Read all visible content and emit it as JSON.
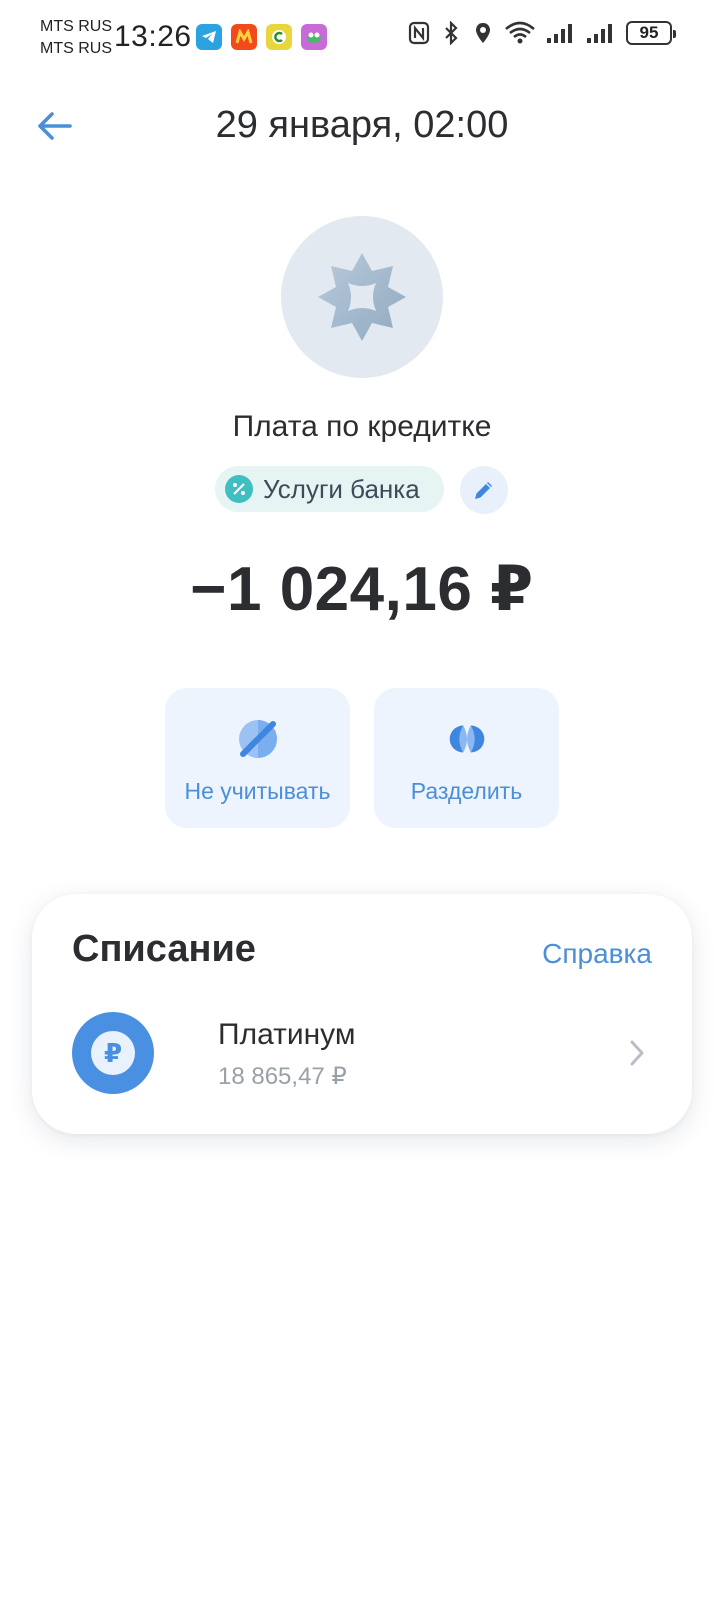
{
  "status_bar": {
    "carrier_1": "MTS RUS",
    "carrier_2": "MTS RUS",
    "time": "13:26",
    "battery": "95",
    "app_icons": [
      "telegram-icon",
      "app-red-icon",
      "app-yellow-icon",
      "app-purple-icon"
    ],
    "system_icons": [
      "nfc-icon",
      "bluetooth-icon",
      "location-icon",
      "wifi-icon",
      "signal-icon",
      "signal-icon"
    ]
  },
  "header": {
    "title": "29 января, 02:00",
    "back_icon": "arrow-left-icon"
  },
  "transaction": {
    "avatar_icon": "bank-badge-icon",
    "name": "Плата по кредитке",
    "category": {
      "label": "Услуги банка",
      "icon": "percent-icon"
    },
    "edit_icon": "pencil-icon",
    "amount": "−1 024,16 ₽"
  },
  "actions": {
    "ignore": {
      "label": "Не учитывать",
      "icon": "eye-off-icon"
    },
    "split": {
      "label": "Разделить",
      "icon": "split-icon"
    }
  },
  "writeoff": {
    "title": "Списание",
    "help": "Справка",
    "account": {
      "icon": "ruble-icon",
      "name": "Платинум",
      "balance": "18 865,47 ₽"
    }
  },
  "colors": {
    "accent": "#4a8fd8",
    "category_chip_bg": "#e7f4f4",
    "category_icon": "#3fbfc0",
    "tile_bg": "#eef4fd",
    "avatar_bg": "#e3e9f1"
  }
}
